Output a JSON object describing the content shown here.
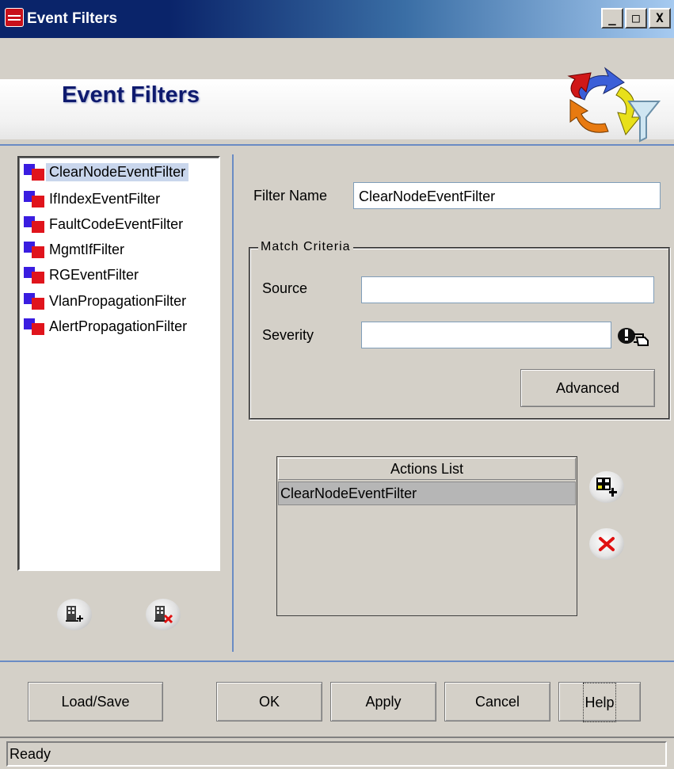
{
  "window": {
    "title": "Event Filters",
    "controls": [
      "_",
      "□",
      "X"
    ]
  },
  "header": {
    "title": "Event Filters",
    "logo_icon": "event-filter-logo"
  },
  "filters": {
    "selected_index": 0,
    "items": [
      {
        "label": "ClearNodeEventFilter"
      },
      {
        "label": "IfIndexEventFilter"
      },
      {
        "label": "FaultCodeEventFilter"
      },
      {
        "label": "MgmtIfFilter"
      },
      {
        "label": "RGEventFilter"
      },
      {
        "label": "VlanPropagationFilter"
      },
      {
        "label": "AlertPropagationFilter"
      }
    ],
    "add_icon": "add-filter-icon",
    "delete_icon": "delete-filter-icon"
  },
  "form": {
    "filter_name_label": "Filter Name",
    "filter_name_value": "ClearNodeEventFilter",
    "match_criteria_label": "Match Criteria",
    "source_label": "Source",
    "source_value": "",
    "severity_label": "Severity",
    "severity_value": "",
    "advanced_label": "Advanced"
  },
  "actions": {
    "header": "Actions List",
    "rows": [
      "ClearNodeEventFilter"
    ],
    "add_icon": "add-action-icon",
    "remove_icon": "remove-action-icon"
  },
  "buttons": {
    "load_save": "Load/Save",
    "ok": "OK",
    "apply": "Apply",
    "cancel": "Cancel",
    "help": "Help"
  },
  "status": {
    "text": "Ready"
  },
  "colors": {
    "title_bar": "#0a246a",
    "header_text": "#0e1a6e",
    "filter_icon_blue": "#3a1de0",
    "filter_icon_red": "#e0141c",
    "separator": "#6a8bc4",
    "selection": "#c9d6ec"
  }
}
